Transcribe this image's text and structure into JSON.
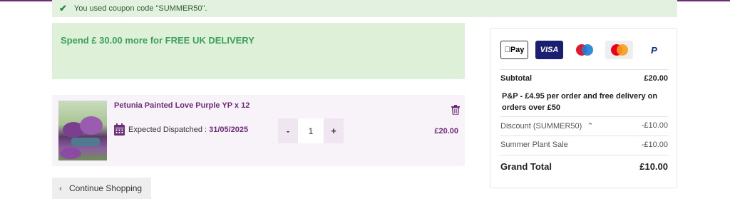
{
  "coupon_banner": {
    "message": "You used coupon code \"SUMMER50\"."
  },
  "delivery_notice": {
    "message": "Spend £ 30.00 more for FREE UK DELIVERY"
  },
  "cart_items": [
    {
      "title": "Petunia Painted Love Purple YP x 12",
      "dispatch_label": "Expected Dispatched :",
      "dispatch_date": "31/05/2025",
      "quantity": "1",
      "decrement_label": "-",
      "increment_label": "+",
      "price": "£20.00"
    }
  ],
  "continue_shopping": {
    "label": "Continue Shopping"
  },
  "payment_methods": {
    "apple_pay": "Pay",
    "visa": "VISA",
    "paypal": "P"
  },
  "summary": {
    "subtotal_label": "Subtotal",
    "subtotal_value": "£20.00",
    "pp_note": "P&P - £4.95 per order and free delivery on orders over £50",
    "discount_label": "Discount (SUMMER50)",
    "discount_value": "-£10.00",
    "sale_label": "Summer Plant Sale",
    "sale_value": "-£10.00",
    "grand_total_label": "Grand Total",
    "grand_total_value": "£10.00"
  },
  "colors": {
    "brand_purple": "#6b2d78",
    "success_green": "#3aa15a",
    "banner_bg": "#e3f1e1",
    "delivery_bg": "#dff0d8"
  }
}
